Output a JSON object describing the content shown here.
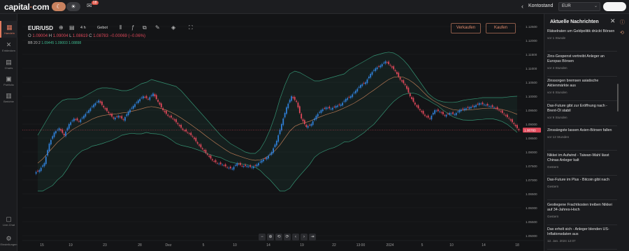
{
  "header": {
    "logo_text": "capital",
    "logo_dot": "·",
    "logo_suffix": "com",
    "theme_moon": "☾",
    "theme_sun": "☀",
    "notif_icon": "envelope-icon",
    "notif_count": "18",
    "account_label": "Kontostand",
    "currency": "EUR"
  },
  "sidebar": {
    "items": [
      {
        "label": "Handeln",
        "icon": "chart-icon",
        "glyph": "▦",
        "active": true
      },
      {
        "label": "Entdecken",
        "icon": "discover-icon",
        "glyph": "✕",
        "active": false
      },
      {
        "label": "Charts",
        "icon": "charts-icon",
        "glyph": "▤",
        "active": false
      },
      {
        "label": "Portfolio",
        "icon": "portfolio-icon",
        "glyph": "▣",
        "active": false
      },
      {
        "label": "Berichte",
        "icon": "reports-icon",
        "glyph": "▥",
        "active": false
      },
      {
        "label": "Live-Chat",
        "icon": "chat-icon",
        "glyph": "▢",
        "active": false
      },
      {
        "label": "Einstellungen",
        "icon": "settings-icon",
        "glyph": "⚙",
        "active": false
      }
    ]
  },
  "toolbar": {
    "symbol": "EUR/USD",
    "timeframe": "4 h",
    "price_type": "Gebot",
    "sell_label": "Verkaufen",
    "buy_label": "Kaufen"
  },
  "ohlc": {
    "o_label": "O",
    "o": "1.09004",
    "h_label": "H",
    "h": "1.09004",
    "l_label": "L",
    "l": "1.08619",
    "c_label": "C",
    "c": "1.08783",
    "change": "−0.00069 (−0.06%)"
  },
  "indicator": {
    "name": "BB 20 2",
    "v1": "1.09445",
    "v2": "1.09003",
    "v3": "1.08898"
  },
  "chart_data": {
    "type": "candlestick",
    "title": "EUR/USD",
    "price_axis_ticks": [
      "1.13000",
      "1.12500",
      "1.12000",
      "1.11500",
      "1.11000",
      "1.10500",
      "1.10000",
      "1.09500",
      "1.09000",
      "1.08500",
      "1.08000",
      "1.07500",
      "1.07000",
      "1.06500",
      "1.06000",
      "1.05500",
      "1.05000"
    ],
    "time_axis_ticks": [
      "15",
      "19",
      "23",
      "28",
      "Dez",
      "5",
      "10",
      "14",
      "19",
      "22",
      "13:00",
      "2024",
      "5",
      "10",
      "14",
      "18"
    ],
    "current_price": "1.08783",
    "ylim": [
      1.05,
      1.13
    ],
    "close_path": [
      1.0735,
      1.076,
      1.083,
      1.087,
      1.0885,
      1.086,
      1.09,
      1.092,
      1.091,
      1.093,
      1.095,
      1.097,
      1.0985,
      1.096,
      1.094,
      1.092,
      1.093,
      1.0915,
      1.0945,
      1.0965,
      1.0985,
      1.1,
      1.099,
      1.101,
      1.098,
      1.095,
      1.093,
      1.092,
      1.09,
      1.088,
      1.087,
      1.0855,
      1.083,
      1.081,
      1.079,
      1.077,
      1.076,
      1.0755,
      1.0745,
      1.074,
      1.076,
      1.075,
      1.075,
      1.0745,
      1.0755,
      1.077,
      1.078,
      1.08,
      1.084,
      1.09,
      1.096,
      1.1,
      1.098,
      1.092,
      1.089,
      1.09,
      1.093,
      1.095,
      1.096,
      1.0955,
      1.0965,
      1.097,
      1.099,
      1.1,
      1.102,
      1.104,
      1.105,
      1.108,
      1.11,
      1.111,
      1.1125,
      1.111,
      1.109,
      1.106,
      1.104,
      1.1,
      1.097,
      1.095,
      1.093,
      1.092,
      1.095,
      1.0945,
      1.093,
      1.094,
      1.0935,
      1.095,
      1.0955,
      1.096,
      1.0965,
      1.0975,
      1.097,
      1.0965,
      1.096,
      1.095,
      1.0935,
      1.092,
      1.09,
      1.0878
    ],
    "bb_upper": [
      1.086,
      1.089,
      1.092,
      1.095,
      1.097,
      1.0985,
      1.099,
      1.099,
      1.099,
      1.0995,
      1.1005,
      1.1015,
      1.1025,
      1.103,
      1.103,
      1.1028,
      1.1024,
      1.102,
      1.102,
      1.1025,
      1.1035,
      1.1045,
      1.105,
      1.106,
      1.1055,
      1.105,
      1.1045,
      1.104,
      1.1035,
      1.102,
      1.1,
      1.098,
      1.096,
      1.094,
      1.092,
      1.09,
      1.088,
      1.086,
      1.0845,
      1.083,
      1.082,
      1.081,
      1.08,
      1.0795,
      1.0795,
      1.081,
      1.084,
      1.088,
      1.093,
      1.099,
      1.104,
      1.108,
      1.109,
      1.1085,
      1.1075,
      1.1065,
      1.1055,
      1.1055,
      1.106,
      1.1065,
      1.107,
      1.1075,
      1.108,
      1.1095,
      1.1105,
      1.1115,
      1.1125,
      1.1135,
      1.1145,
      1.115,
      1.1155,
      1.1158,
      1.1155,
      1.1145,
      1.113,
      1.111,
      1.1085,
      1.106,
      1.1035,
      1.101,
      1.0995,
      1.0985,
      1.098,
      1.0978,
      1.0978,
      1.098,
      1.0985,
      1.0988,
      1.099,
      1.0992,
      1.0995,
      1.0995,
      1.0995,
      1.0995,
      1.0995,
      1.0997,
      1.0999,
      1.1
    ],
    "bb_middle": [
      1.076,
      1.0775,
      1.0795,
      1.0815,
      1.0835,
      1.085,
      1.0865,
      1.088,
      1.089,
      1.09,
      1.0908,
      1.0918,
      1.0925,
      1.093,
      1.0933,
      1.0935,
      1.0937,
      1.094,
      1.0942,
      1.0946,
      1.095,
      1.0955,
      1.096,
      1.0963,
      1.096,
      1.0956,
      1.095,
      1.0942,
      1.0933,
      1.0922,
      1.091,
      1.0898,
      1.0885,
      1.0872,
      1.0858,
      1.0845,
      1.0832,
      1.082,
      1.0808,
      1.0797,
      1.079,
      1.0784,
      1.0778,
      1.0773,
      1.077,
      1.0772,
      1.0778,
      1.079,
      1.0805,
      1.0825,
      1.085,
      1.0875,
      1.0892,
      1.09,
      1.0905,
      1.091,
      1.0918,
      1.0925,
      1.0932,
      1.0938,
      1.0943,
      1.095,
      1.0958,
      1.0966,
      1.0975,
      1.0986,
      1.0997,
      1.101,
      1.1022,
      1.1035,
      1.1048,
      1.106,
      1.1068,
      1.107,
      1.1068,
      1.106,
      1.1048,
      1.1033,
      1.1015,
      1.0998,
      1.0985,
      1.0975,
      1.0965,
      1.0958,
      1.0952,
      1.095,
      1.095,
      1.0951,
      1.0952,
      1.0954,
      1.0956,
      1.0957,
      1.0957,
      1.0955,
      1.0952,
      1.0948,
      1.0942,
      1.0935
    ],
    "bb_lower": [
      1.066,
      1.066,
      1.067,
      1.068,
      1.07,
      1.0715,
      1.074,
      1.077,
      1.079,
      1.0805,
      1.0811,
      1.0821,
      1.0825,
      1.083,
      1.0836,
      1.0842,
      1.085,
      1.086,
      1.0864,
      1.0867,
      1.0865,
      1.0865,
      1.087,
      1.0866,
      1.0865,
      1.0862,
      1.0855,
      1.0844,
      1.0831,
      1.0824,
      1.082,
      1.0816,
      1.081,
      1.0804,
      1.0796,
      1.079,
      1.0784,
      1.078,
      1.0771,
      1.0764,
      1.076,
      1.0758,
      1.0756,
      1.0751,
      1.0745,
      1.0734,
      1.0716,
      1.07,
      1.068,
      1.066,
      1.066,
      1.067,
      1.0694,
      1.0715,
      1.0735,
      1.0755,
      1.0781,
      1.0795,
      1.0804,
      1.0811,
      1.0816,
      1.0825,
      1.0836,
      1.0837,
      1.0845,
      1.0857,
      1.0869,
      1.0885,
      1.0899,
      1.092,
      1.0941,
      1.0962,
      1.0981,
      1.0995,
      1.1006,
      1.101,
      1.1011,
      1.1006,
      1.0995,
      1.0986,
      1.0975,
      1.0965,
      1.095,
      1.0938,
      1.0926,
      1.092,
      1.0915,
      1.0914,
      1.0914,
      1.0916,
      1.0917,
      1.0919,
      1.0919,
      1.0915,
      1.0909,
      1.0899,
      1.0885,
      1.087
    ]
  },
  "chart_controls": [
    "−",
    "⊕",
    "⟲",
    "⟳",
    "‹",
    "›",
    "⇥"
  ],
  "news": {
    "header": "Aktuelle Nachrichten",
    "items": [
      {
        "title": "Rätselraten um Geldpolitik drückt Börsen",
        "time": "vor 1 Stunde"
      },
      {
        "title": "Zins-Gespenst vertreibt Anleger an Europas Börsen",
        "time": "vor 4 Stunden"
      },
      {
        "title": "Zinssorgen bremsen asiatische Aktienmärkte aus",
        "time": "vor 6 Stunden"
      },
      {
        "title": "Dax-Future gibt zur Eröffnung nach - Brent-Öl stabil",
        "time": "vor 9 Stunden"
      },
      {
        "title": "Zinssängste lassen Asien-Börsen fallen",
        "time": "vor 12 Stunden"
      },
      {
        "title": "Nikkei im Aufwind - Taiwan-Wahl lässt Chinas Anleger kalt",
        "time": "Gestern"
      },
      {
        "title": "Dax-Future im Plus - Bitcoin gibt nach",
        "time": "Gestern"
      },
      {
        "title": "Gestiegene Frachtkosten treiben Nikkei auf 34-Jahres-Hoch",
        "time": "Gestern"
      },
      {
        "title": "Dax erholt sich - Anleger blenden US-Inflationsdaten aus",
        "time": "12. Jan. 2024 12:07"
      }
    ]
  },
  "colors": {
    "up": "#2f7fd6",
    "down": "#e0485a",
    "band": "#3fb98f",
    "middle": "#d98c5f",
    "accent": "#e37a5f"
  }
}
